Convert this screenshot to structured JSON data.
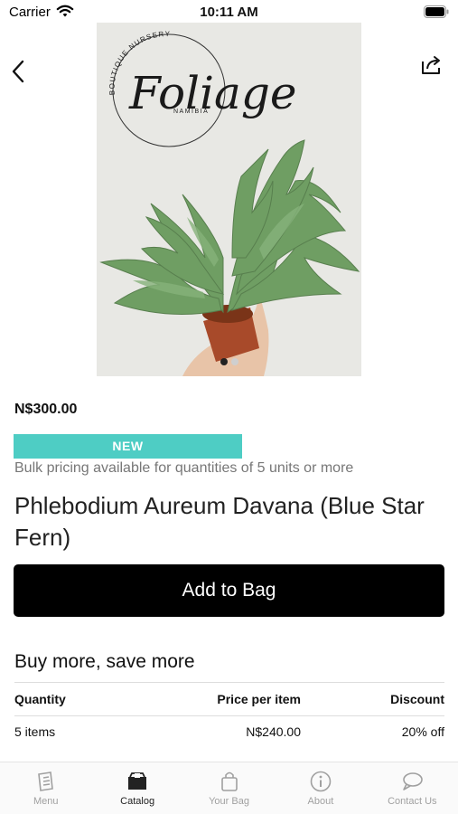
{
  "status_bar": {
    "carrier": "Carrier",
    "time": "10:11 AM"
  },
  "product": {
    "price": "N$300.00",
    "badge": "NEW",
    "bulk_note": "Bulk pricing available for quantities of 5 units or more",
    "title": "Phlebodium Aureum Davana (Blue Star Fern)",
    "image": {
      "logo_arc_text": "BOUTIQUE NURSERY",
      "logo_script": "Foliage",
      "logo_sub": "NAMIBIA",
      "slides": 2,
      "active_slide": 1
    }
  },
  "actions": {
    "add_to_bag_label": "Add to Bag"
  },
  "bulk_pricing": {
    "title": "Buy more, save more",
    "headers": {
      "quantity": "Quantity",
      "price": "Price per item",
      "discount": "Discount"
    },
    "rows": [
      {
        "quantity": "5 items",
        "price": "N$240.00",
        "discount": "20% off"
      }
    ]
  },
  "tab_bar": {
    "items": [
      {
        "label": "Menu",
        "icon": "menu-book-icon",
        "active": false
      },
      {
        "label": "Catalog",
        "icon": "catalog-box-icon",
        "active": true
      },
      {
        "label": "Your Bag",
        "icon": "shopping-bag-icon",
        "active": false
      },
      {
        "label": "About",
        "icon": "info-icon",
        "active": false
      },
      {
        "label": "Contact Us",
        "icon": "chat-bubble-icon",
        "active": false
      }
    ]
  },
  "colors": {
    "badge": "#4ecdc4",
    "button": "#000000",
    "tab_inactive": "#a0a0a0"
  }
}
